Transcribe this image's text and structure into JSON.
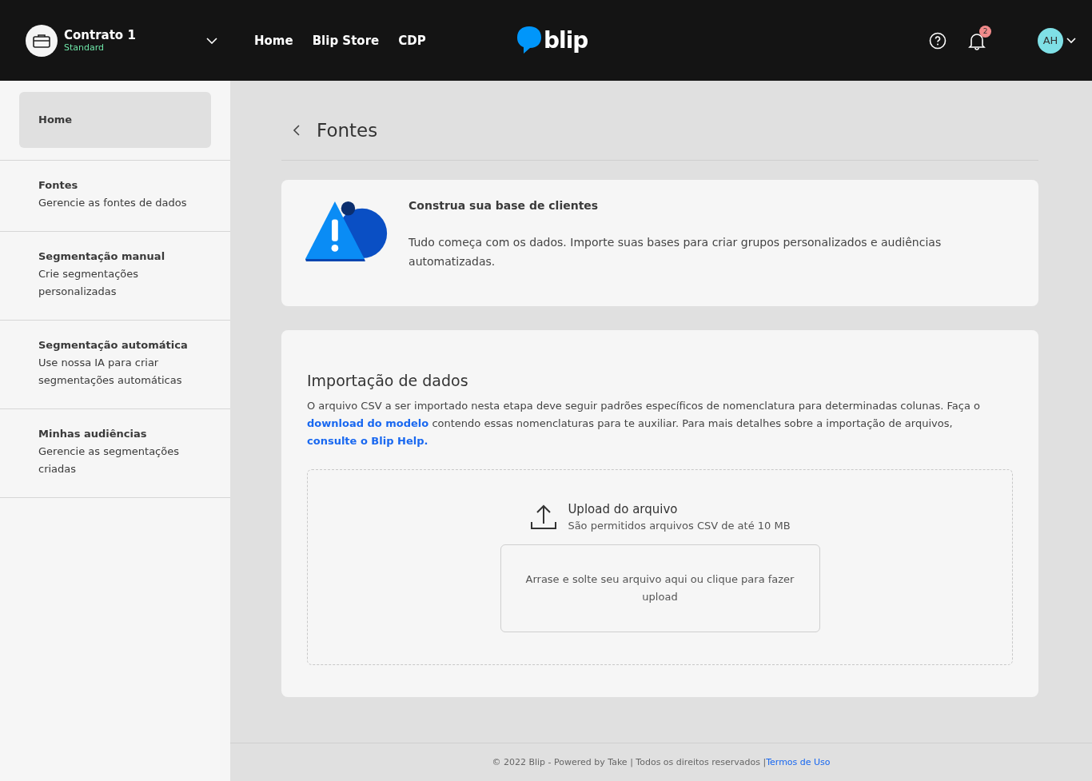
{
  "topbar": {
    "contract": {
      "name": "Contrato 1",
      "plan": "Standard"
    },
    "nav": [
      {
        "label": "Home"
      },
      {
        "label": "Blip Store"
      },
      {
        "label": "CDP"
      }
    ],
    "logo": "blip",
    "notifications": "2",
    "avatar": "AH"
  },
  "sidebar": {
    "items": [
      {
        "title": "Home",
        "selected": true
      },
      {
        "title": "Fontes",
        "subtitle": "Gerencie as fontes de dados",
        "selected": false
      },
      {
        "title": "Segmentação manual",
        "subtitle": "Crie segmentações personalizadas",
        "selected": false
      },
      {
        "title": "Segmentação automática",
        "subtitle": "Use nossa IA para criar segmentações automáticas",
        "selected": false
      },
      {
        "title": "Minhas audiências",
        "subtitle": "Gerencie as segmentações criadas",
        "selected": false
      }
    ]
  },
  "page": {
    "title": "Fontes"
  },
  "banner": {
    "title": "Construa sua base de clientes",
    "text": "Tudo começa com os dados. Importe suas bases para criar grupos personalizados e audiências automatizadas."
  },
  "import": {
    "title": "Importação de dados",
    "description": [
      {
        "kind": "text",
        "text": "O arquivo CSV a ser importado nesta etapa deve seguir padrões específicos de nomenclatura para determinadas colunas. Faça o "
      },
      {
        "kind": "link",
        "text": "download do modelo"
      },
      {
        "kind": "text",
        "text": " contendo essas nomenclaturas para te auxiliar. Para mais detalhes sobre a importação de arquivos, "
      },
      {
        "kind": "link",
        "text": "consulte o Blip Help."
      }
    ],
    "upload_title": "Upload do arquivo",
    "upload_hint": "São permitidos arquivos CSV de até 10 MB",
    "dropzone": "Arrase e solte seu arquivo aqui ou clique para fazer upload"
  },
  "footer": {
    "text": "© 2022 Blip - Powered by Take | Todos os direitos reservados |",
    "link": "Termos de Uso"
  }
}
